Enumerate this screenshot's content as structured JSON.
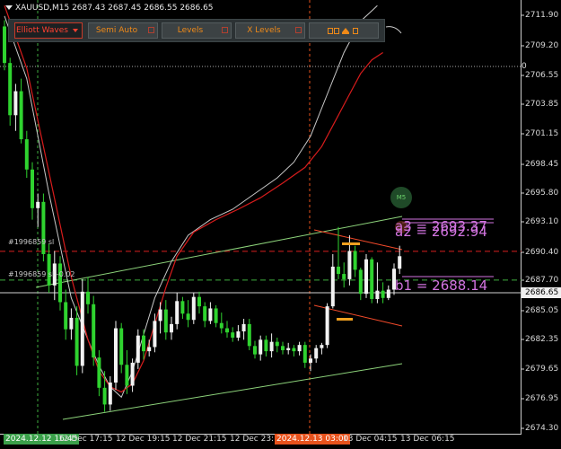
{
  "symbol": {
    "title": "XAUUSD,M15  2687.43 2687.45 2686.55 2686.65"
  },
  "toolbar": {
    "elliott_waves": "Elliott Waves",
    "semi_auto": "Semi Auto",
    "levels": "Levels",
    "x_levels": "X Levels"
  },
  "y_axis": {
    "ticks": [
      "2711.90",
      "2709.20",
      "2706.55",
      "2703.85",
      "2701.15",
      "2698.45",
      "2695.80",
      "2693.10",
      "2690.40",
      "2687.70",
      "2685.05",
      "2682.35",
      "2679.65",
      "2676.95",
      "2674.30"
    ],
    "zero_label": "0",
    "current_price": "2686.65"
  },
  "x_axis": {
    "labels": [
      {
        "text": "2024.12.12 16:45",
        "style": "hl-green"
      },
      {
        "text": "12 Dec 17:15",
        "style": ""
      },
      {
        "text": "12 Dec 19:15",
        "style": ""
      },
      {
        "text": "12 Dec 21:15",
        "style": ""
      },
      {
        "text": "12 Dec 23:1",
        "style": ""
      },
      {
        "text": "2024.12.13 03:00",
        "style": "hl-orange"
      },
      {
        "text": "13 Dec 04:15",
        "style": ""
      },
      {
        "text": "13 Dec 06:15",
        "style": ""
      }
    ]
  },
  "annotations": {
    "sl1": "#1996859 sl",
    "sl2": "#1996859 sl -0.02",
    "badge": "M5",
    "label_a3": "a3 = 2693.37",
    "label_a2": "a2 = 2692.94",
    "label_b1": "b1 = 2688.14"
  },
  "colors": {
    "background": "#000000",
    "bull_candle": "#f2f2f2",
    "bear_candle": "#2fd32f",
    "ma_fast": "#c8c8c8",
    "ma_slow": "#d81c1c",
    "channel": "#8cd27a",
    "sl_line": "#d82020",
    "wedge": "#f24a2a",
    "label_text": "#d274e0"
  },
  "chart_data": {
    "type": "candlestick",
    "symbol": "XAUUSD",
    "timeframe": "M15",
    "ylim": [
      2673.0,
      2713.5
    ],
    "candles": [
      [
        2712.0,
        2712.6,
        2707.8,
        2708.5
      ],
      [
        2708.5,
        2709.0,
        2702.5,
        2703.5
      ],
      [
        2703.5,
        2706.5,
        2702.0,
        2705.8
      ],
      [
        2705.8,
        2707.0,
        2700.8,
        2701.2
      ],
      [
        2701.2,
        2702.0,
        2697.5,
        2698.3
      ],
      [
        2698.3,
        2699.0,
        2693.5,
        2694.6
      ],
      [
        2694.6,
        2696.0,
        2692.8,
        2695.2
      ],
      [
        2695.2,
        2696.0,
        2689.5,
        2690.2
      ],
      [
        2690.2,
        2691.2,
        2686.5,
        2687.2
      ],
      [
        2687.2,
        2690.5,
        2685.8,
        2689.3
      ],
      [
        2689.3,
        2690.0,
        2684.8,
        2685.6
      ],
      [
        2685.6,
        2686.8,
        2682.0,
        2683.0
      ],
      [
        2683.0,
        2685.0,
        2682.0,
        2684.1
      ],
      [
        2684.1,
        2685.2,
        2678.6,
        2679.5
      ],
      [
        2679.5,
        2687.8,
        2678.8,
        2686.6
      ],
      [
        2686.6,
        2688.0,
        2684.5,
        2685.4
      ],
      [
        2685.4,
        2686.2,
        2679.5,
        2680.3
      ],
      [
        2680.3,
        2681.0,
        2676.6,
        2677.4
      ],
      [
        2677.4,
        2679.0,
        2675.1,
        2675.8
      ],
      [
        2675.8,
        2678.5,
        2675.2,
        2677.9
      ],
      [
        2677.9,
        2683.8,
        2677.2,
        2683.1
      ],
      [
        2683.1,
        2683.6,
        2678.8,
        2679.6
      ],
      [
        2679.6,
        2681.0,
        2676.8,
        2677.6
      ],
      [
        2677.6,
        2680.2,
        2677.0,
        2679.8
      ],
      [
        2679.8,
        2683.0,
        2679.2,
        2682.4
      ],
      [
        2682.4,
        2683.0,
        2680.1,
        2680.9
      ],
      [
        2680.9,
        2682.0,
        2680.4,
        2681.3
      ],
      [
        2681.3,
        2684.5,
        2680.8,
        2683.8
      ],
      [
        2683.8,
        2685.6,
        2682.6,
        2684.9
      ],
      [
        2684.9,
        2685.8,
        2682.0,
        2682.7
      ],
      [
        2682.7,
        2684.2,
        2682.0,
        2683.5
      ],
      [
        2683.5,
        2686.5,
        2683.0,
        2685.7
      ],
      [
        2685.7,
        2686.1,
        2684.0,
        2684.5
      ],
      [
        2684.5,
        2685.8,
        2683.2,
        2683.9
      ],
      [
        2683.9,
        2686.5,
        2683.5,
        2686.1
      ],
      [
        2686.1,
        2686.6,
        2684.5,
        2685.2
      ],
      [
        2685.2,
        2685.6,
        2683.2,
        2683.8
      ],
      [
        2683.8,
        2685.6,
        2683.5,
        2685.0
      ],
      [
        2685.0,
        2685.3,
        2683.2,
        2683.6
      ],
      [
        2683.6,
        2684.6,
        2682.6,
        2683.1
      ],
      [
        2683.1,
        2683.8,
        2682.2,
        2682.7
      ],
      [
        2682.7,
        2683.2,
        2681.8,
        2682.2
      ],
      [
        2682.2,
        2683.4,
        2681.9,
        2682.8
      ],
      [
        2682.8,
        2684.0,
        2682.0,
        2683.5
      ],
      [
        2683.5,
        2684.0,
        2681.0,
        2681.4
      ],
      [
        2681.4,
        2681.9,
        2680.2,
        2680.6
      ],
      [
        2680.6,
        2682.4,
        2680.0,
        2682.0
      ],
      [
        2682.0,
        2682.4,
        2680.4,
        2680.9
      ],
      [
        2680.9,
        2682.6,
        2680.3,
        2681.8
      ],
      [
        2681.8,
        2682.2,
        2680.8,
        2681.4
      ],
      [
        2681.4,
        2681.8,
        2680.6,
        2681.0
      ],
      [
        2681.0,
        2681.7,
        2680.6,
        2681.2
      ],
      [
        2681.2,
        2681.5,
        2680.4,
        2680.9
      ],
      [
        2680.9,
        2681.8,
        2680.5,
        2681.5
      ],
      [
        2681.5,
        2681.8,
        2679.3,
        2679.8
      ],
      [
        2679.8,
        2680.6,
        2679.0,
        2680.2
      ],
      [
        2680.2,
        2681.5,
        2679.8,
        2681.2
      ],
      [
        2681.2,
        2681.7,
        2680.6,
        2681.5
      ],
      [
        2681.5,
        2685.5,
        2681.2,
        2685.2
      ],
      [
        2685.2,
        2690.2,
        2685.0,
        2689.0
      ],
      [
        2689.0,
        2692.8,
        2687.8,
        2688.3
      ],
      [
        2688.3,
        2689.4,
        2687.0,
        2687.8
      ],
      [
        2687.8,
        2692.0,
        2687.2,
        2690.5
      ],
      [
        2690.5,
        2691.0,
        2688.0,
        2688.7
      ],
      [
        2688.7,
        2688.9,
        2685.8,
        2686.4
      ],
      [
        2686.4,
        2690.2,
        2686.0,
        2689.7
      ],
      [
        2689.7,
        2689.9,
        2685.5,
        2685.9
      ],
      [
        2685.9,
        2689.4,
        2685.5,
        2686.7
      ],
      [
        2686.7,
        2687.5,
        2685.5,
        2686.0
      ],
      [
        2686.0,
        2687.2,
        2685.8,
        2686.8
      ],
      [
        2686.8,
        2689.3,
        2686.3,
        2688.8
      ],
      [
        2688.8,
        2691.0,
        2688.3,
        2690.0
      ],
      [
        2690.0,
        2690.6,
        2687.5,
        2688.0
      ],
      [
        2688.0,
        2688.4,
        2686.2,
        2686.6
      ]
    ],
    "ma_fast": [
      [
        0,
        2713.0
      ],
      [
        4,
        2707.0
      ],
      [
        8,
        2696.0
      ],
      [
        12,
        2686.0
      ],
      [
        15,
        2682.0
      ],
      [
        17,
        2679.5
      ],
      [
        19,
        2677.5
      ],
      [
        21,
        2676.5
      ],
      [
        23,
        2679.0
      ],
      [
        25,
        2682.5
      ],
      [
        27,
        2686.0
      ],
      [
        30,
        2689.5
      ],
      [
        33,
        2692.0
      ],
      [
        37,
        2693.5
      ],
      [
        41,
        2694.5
      ],
      [
        45,
        2696.0
      ],
      [
        49,
        2697.5
      ],
      [
        52,
        2699.0
      ],
      [
        55,
        2701.5
      ],
      [
        58,
        2705.5
      ],
      [
        61,
        2709.5
      ],
      [
        64,
        2712.5
      ],
      [
        67,
        2714.0
      ]
    ],
    "ma_slow": [
      [
        0,
        2714.0
      ],
      [
        4,
        2708.0
      ],
      [
        8,
        2698.0
      ],
      [
        12,
        2688.0
      ],
      [
        15,
        2682.0
      ],
      [
        17,
        2679.0
      ],
      [
        19,
        2677.5
      ],
      [
        21,
        2677.0
      ],
      [
        23,
        2677.8
      ],
      [
        25,
        2680.0
      ],
      [
        27,
        2683.5
      ],
      [
        29,
        2687.0
      ],
      [
        31,
        2690.0
      ],
      [
        34,
        2692.3
      ],
      [
        38,
        2693.5
      ],
      [
        42,
        2694.5
      ],
      [
        46,
        2695.6
      ],
      [
        50,
        2697.0
      ],
      [
        54,
        2698.5
      ],
      [
        57,
        2700.5
      ],
      [
        60,
        2703.5
      ],
      [
        62,
        2705.5
      ],
      [
        64,
        2707.5
      ],
      [
        66,
        2708.8
      ],
      [
        68,
        2709.5
      ]
    ],
    "horizontal_levels": [
      {
        "name": "#1996859 sl",
        "price": 2690.47
      },
      {
        "name": "#1996859 sl -0.02",
        "price": 2687.71
      },
      {
        "name": "a3",
        "price": 2693.37
      },
      {
        "name": "a2",
        "price": 2692.94
      },
      {
        "name": "b1",
        "price": 2688.14
      }
    ],
    "grid": false
  }
}
